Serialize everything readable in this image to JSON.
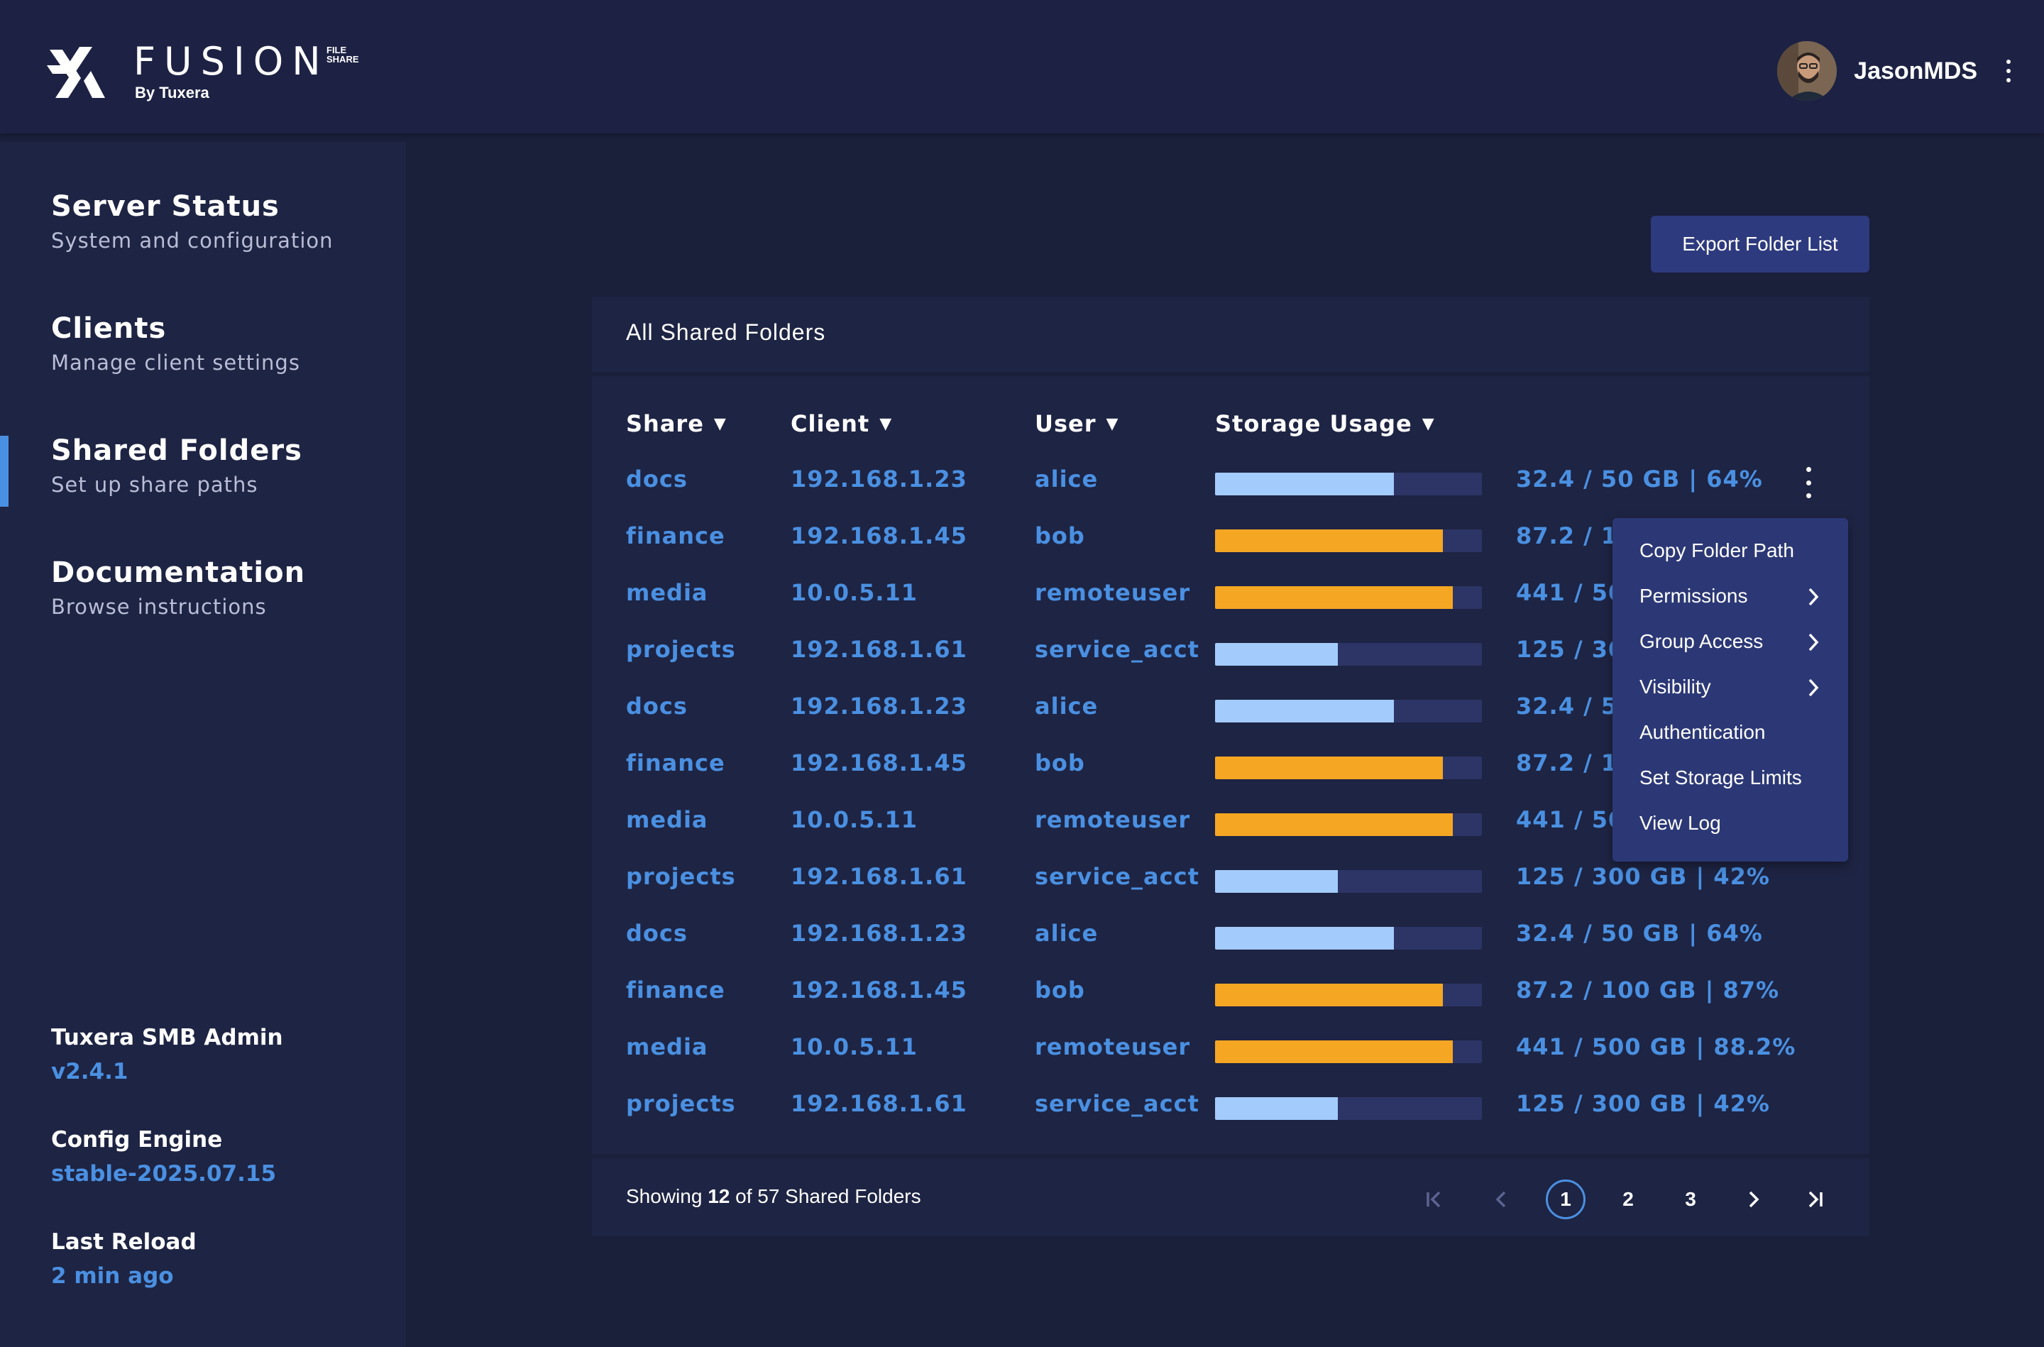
{
  "header": {
    "logo_word": "FUSION",
    "logo_tag_line1": "FILE",
    "logo_tag_line2": "SHARE",
    "logo_sub": "By Tuxera",
    "username": "JasonMDS"
  },
  "sidebar": {
    "items": [
      {
        "title": "Server Status",
        "subtitle": "System and configuration"
      },
      {
        "title": "Clients",
        "subtitle": "Manage client settings"
      },
      {
        "title": "Shared Folders",
        "subtitle": "Set up share paths"
      },
      {
        "title": "Documentation",
        "subtitle": "Browse instructions"
      }
    ],
    "active_index": 2,
    "meta": [
      {
        "label": "Tuxera SMB Admin",
        "value": "v2.4.1"
      },
      {
        "label": "Config Engine",
        "value": "stable-2025.07.15"
      },
      {
        "label": "Last Reload",
        "value": "2 min ago"
      }
    ]
  },
  "main": {
    "export_button": "Export Folder List",
    "card_title": "All Shared Folders",
    "columns": [
      "Share",
      "Client",
      "User",
      "Storage Usage"
    ],
    "sort_arrow": "▼",
    "rows": [
      {
        "share": "docs",
        "client": "192.168.1.23",
        "user": "alice",
        "usage": "32.4 / 50 GB | 64%",
        "fraction": 0.67,
        "color": "#a3cbfb"
      },
      {
        "share": "finance",
        "client": "192.168.1.45",
        "user": "bob",
        "usage": "87.2 / 100 GB | 87%",
        "fraction": 0.855,
        "color": "#f5a623"
      },
      {
        "share": "media",
        "client": "10.0.5.11",
        "user": "remoteuser",
        "usage": "441 / 500 GB | 88.2%",
        "fraction": 0.89,
        "color": "#f5a623"
      },
      {
        "share": "projects",
        "client": "192.168.1.61",
        "user": "service_acct",
        "usage": "125 / 300 GB | 42%",
        "fraction": 0.46,
        "color": "#a3cbfb"
      },
      {
        "share": "docs",
        "client": "192.168.1.23",
        "user": "alice",
        "usage": "32.4 / 50 GB | 64%",
        "fraction": 0.67,
        "color": "#a3cbfb"
      },
      {
        "share": "finance",
        "client": "192.168.1.45",
        "user": "bob",
        "usage": "87.2 / 100 GB | 87%",
        "fraction": 0.855,
        "color": "#f5a623"
      },
      {
        "share": "media",
        "client": "10.0.5.11",
        "user": "remoteuser",
        "usage": "441 / 500 GB | 88.2%",
        "fraction": 0.89,
        "color": "#f5a623"
      },
      {
        "share": "projects",
        "client": "192.168.1.61",
        "user": "service_acct",
        "usage": "125 / 300 GB | 42%",
        "fraction": 0.46,
        "color": "#a3cbfb"
      },
      {
        "share": "docs",
        "client": "192.168.1.23",
        "user": "alice",
        "usage": "32.4 / 50 GB | 64%",
        "fraction": 0.67,
        "color": "#a3cbfb"
      },
      {
        "share": "finance",
        "client": "192.168.1.45",
        "user": "bob",
        "usage": "87.2 / 100 GB | 87%",
        "fraction": 0.855,
        "color": "#f5a623"
      },
      {
        "share": "media",
        "client": "10.0.5.11",
        "user": "remoteuser",
        "usage": "441 / 500 GB | 88.2%",
        "fraction": 0.89,
        "color": "#f5a623"
      },
      {
        "share": "projects",
        "client": "192.168.1.61",
        "user": "service_acct",
        "usage": "125 / 300 GB | 42%",
        "fraction": 0.46,
        "color": "#a3cbfb"
      }
    ],
    "context_menu": [
      {
        "label": "Copy Folder Path",
        "submenu": false
      },
      {
        "label": "Permissions",
        "submenu": true
      },
      {
        "label": "Group Access",
        "submenu": true
      },
      {
        "label": "Visibility",
        "submenu": true
      },
      {
        "label": "Authentication",
        "submenu": false
      },
      {
        "label": "Set Storage Limits",
        "submenu": false
      },
      {
        "label": "View Log",
        "submenu": false
      }
    ],
    "footer": {
      "showing_prefix": "Showing",
      "showing_count": "12",
      "showing_suffix": "of 57 Shared Folders",
      "pages": [
        "1",
        "2",
        "3"
      ],
      "current_page": "1"
    }
  },
  "colors": {
    "accent": "#4a90e2",
    "bar_low": "#a3cbfb",
    "bar_high": "#f5a623",
    "bar_track": "#2c3566"
  }
}
